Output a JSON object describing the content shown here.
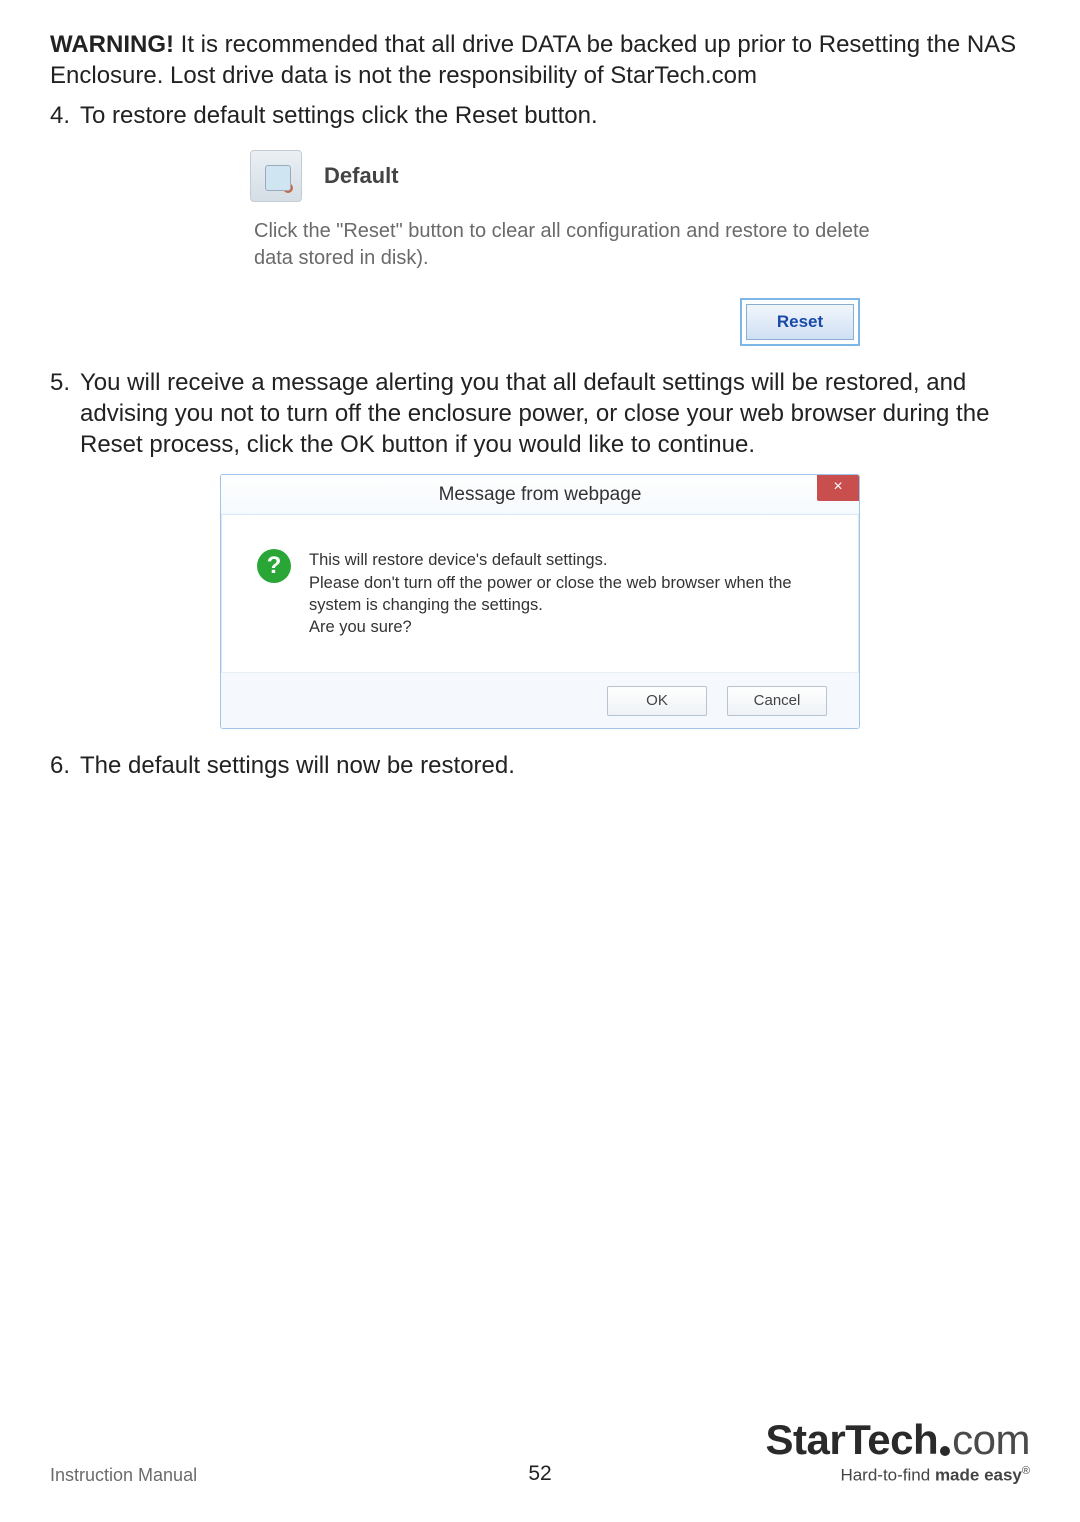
{
  "warning": {
    "label": "WARNING!",
    "text": " It is recommended that all drive DATA be backed up prior to Resetting the NAS Enclosure. Lost drive data is not the responsibility of StarTech.com"
  },
  "steps": {
    "s4": {
      "num": "4.",
      "text": "To restore default settings click the Reset button."
    },
    "s5": {
      "num": "5.",
      "text": "You will receive a message alerting you that all default settings will be restored, and advising you not to turn off the enclosure power, or close your web browser during the Reset process, click the OK button if you would like to continue."
    },
    "s6": {
      "num": "6.",
      "text": "The default settings will now be restored."
    }
  },
  "default_panel": {
    "title": "Default",
    "description": "Click the \"Reset\" button to clear all configuration and restore to delete data stored in disk).",
    "reset_label": "Reset"
  },
  "dialog": {
    "title": "Message from webpage",
    "close": "×",
    "qmark": "?",
    "message": "This will restore device's default settings.\nPlease don't turn off the power or close the web browser when the system is changing the settings.\nAre you sure?",
    "ok": "OK",
    "cancel": "Cancel"
  },
  "footer": {
    "left": "Instruction Manual",
    "page": "52",
    "logo_bold": "StarTech",
    "logo_thin": "com",
    "tag_pre": "Hard-to-find ",
    "tag_bold": "made easy",
    "tag_reg": "®"
  }
}
